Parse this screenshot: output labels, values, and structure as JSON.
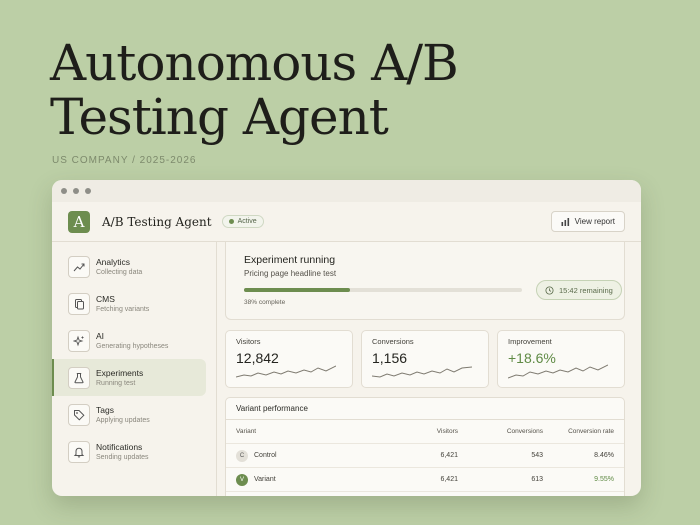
{
  "hero": {
    "title_line1": "Autonomous A/B",
    "title_line2": "Testing Agent",
    "subtitle": "US COMPANY / 2025-2026"
  },
  "app": {
    "name": "A/B Testing Agent",
    "logo_letter": "A",
    "status": "Active",
    "view_report_label": "View report"
  },
  "sidebar": {
    "items": [
      {
        "label": "Analytics",
        "sub": "Collecting data",
        "icon": "trend-icon"
      },
      {
        "label": "CMS",
        "sub": "Fetching variants",
        "icon": "document-icon"
      },
      {
        "label": "AI",
        "sub": "Generating hypotheses",
        "icon": "sparkle-icon"
      },
      {
        "label": "Experiments",
        "sub": "Running test",
        "icon": "flask-icon",
        "active": true
      },
      {
        "label": "Tags",
        "sub": "Applying updates",
        "icon": "tag-icon"
      },
      {
        "label": "Notifications",
        "sub": "Sending updates",
        "icon": "bell-icon"
      }
    ]
  },
  "experiment": {
    "title": "Experiment running",
    "subtitle": "Pricing page headline test",
    "progress": 0.38,
    "progress_label": "38% complete",
    "remaining": "15:42 remaining"
  },
  "stats": [
    {
      "label": "Visitors",
      "value": "12,842"
    },
    {
      "label": "Conversions",
      "value": "1,156"
    },
    {
      "label": "Improvement",
      "value": "+18.6%"
    }
  ],
  "table": {
    "title": "Variant performance",
    "headers": [
      "Variant",
      "Visitors",
      "Conversions",
      "Conversion rate"
    ],
    "rows": [
      {
        "initial": "C",
        "variant": "Control",
        "visitors": "6,421",
        "conversions": "543",
        "rate": "8.46%"
      },
      {
        "initial": "V",
        "variant": "Variant",
        "visitors": "6,421",
        "conversions": "613",
        "rate": "9.55%"
      }
    ]
  },
  "colors": {
    "background": "#bccfa6",
    "accent": "#6d8d4f",
    "window": "#f6f3ec"
  }
}
